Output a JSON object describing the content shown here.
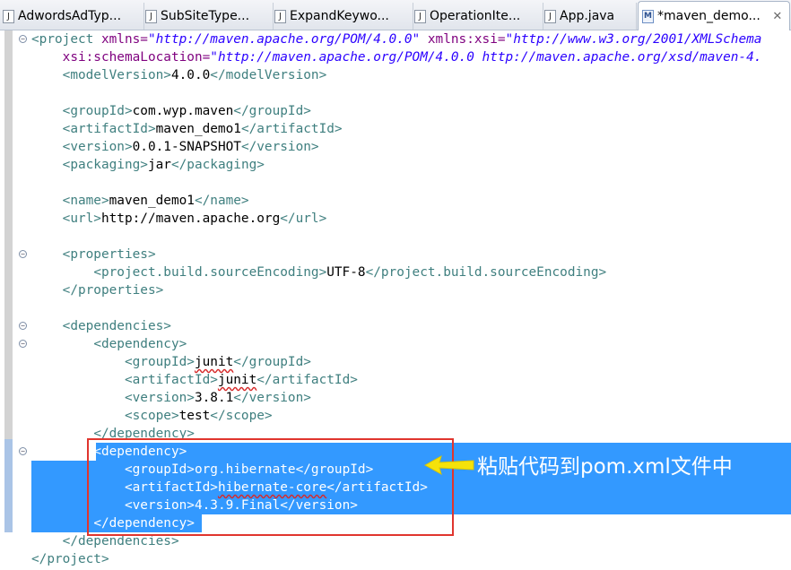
{
  "tabs": [
    {
      "label": "AdwordsAdTyp...",
      "icon": "java-file-icon",
      "active": false
    },
    {
      "label": "SubSiteType...",
      "icon": "java-file-icon",
      "active": false
    },
    {
      "label": "ExpandKeywo...",
      "icon": "java-file-icon",
      "active": false
    },
    {
      "label": "OperationIte...",
      "icon": "java-file-icon",
      "active": false
    },
    {
      "label": "App.java",
      "icon": "java-file-icon",
      "active": false
    },
    {
      "label": "*maven_demo...",
      "icon": "maven-pom-icon",
      "active": true,
      "close": "✕"
    }
  ],
  "code": {
    "l1": {
      "t1": "<project",
      "a1": " xmlns=",
      "v1": "\"http://maven.apache.org/POM/4.0.0\"",
      "a2": " xmlns:xsi=",
      "v2": "\"http://www.w3.org/2001/XMLSchema"
    },
    "l2": {
      "a1": "xsi:schemaLocation=",
      "v1": "\"http://maven.apache.org/POM/4.0.0 http://maven.apache.org/xsd/maven-4."
    },
    "l3": {
      "o": "<modelVersion>",
      "x": "4.0.0",
      "c": "</modelVersion>"
    },
    "l5": {
      "o": "<groupId>",
      "x": "com.wyp.maven",
      "c": "</groupId>"
    },
    "l6": {
      "o": "<artifactId>",
      "x": "maven_demo1",
      "c": "</artifactId>"
    },
    "l7": {
      "o": "<version>",
      "x": "0.0.1-SNAPSHOT",
      "c": "</version>"
    },
    "l8": {
      "o": "<packaging>",
      "x": "jar",
      "c": "</packaging>"
    },
    "l10": {
      "o": "<name>",
      "x": "maven_demo1",
      "c": "</name>"
    },
    "l11": {
      "o": "<url>",
      "x": "http://maven.apache.org",
      "c": "</url>"
    },
    "l13": {
      "o": "<properties>"
    },
    "l14": {
      "o": "<project.build.sourceEncoding>",
      "x": "UTF-8",
      "c": "</project.build.sourceEncoding>"
    },
    "l15": {
      "c": "</properties>"
    },
    "l17": {
      "o": "<dependencies>"
    },
    "l18": {
      "o": "<dependency>"
    },
    "l19": {
      "o": "<groupId>",
      "x": "junit",
      "c": "</groupId>"
    },
    "l20": {
      "o": "<artifactId>",
      "x": "junit",
      "c": "</artifactId>"
    },
    "l21": {
      "o": "<version>",
      "x": "3.8.1",
      "c": "</version>"
    },
    "l22": {
      "o": "<scope>",
      "x": "test",
      "c": "</scope>"
    },
    "l23": {
      "c": "</dependency>"
    },
    "l24": {
      "o": "<dependency>"
    },
    "l25": {
      "o": "<groupId>",
      "x": "org.hibernate",
      "c": "</groupId>"
    },
    "l26": {
      "o": "<artifactId>",
      "x": "hibernate-core",
      "c": "</artifactId>"
    },
    "l27": {
      "o": "<version>",
      "x": "4.3.9.Final",
      "c": "</version>"
    },
    "l28": {
      "c": "</dependency>"
    },
    "l29": {
      "c": "</dependencies>"
    },
    "l30": {
      "c": "</project>"
    }
  },
  "annotation": {
    "text": "粘贴代码到pom.xml文件中",
    "box_color": "#e0352e",
    "arrow_color": "#f5e20a"
  },
  "colors": {
    "tag": "#3f7f7f",
    "attribute": "#7f007f",
    "value": "#2a00ff",
    "selection": "#3399ff"
  }
}
